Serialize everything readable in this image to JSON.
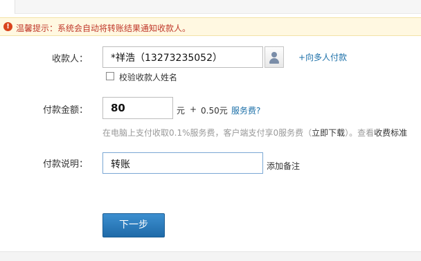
{
  "notice": {
    "icon": "exclamation-icon",
    "text": "温馨提示：系统会自动将转账结果通知收款人。"
  },
  "payee": {
    "label": "收款人：",
    "value": "*祥浩（13273235052）",
    "contact_icon": "contact-person-icon",
    "multi_link": "+向多人付款",
    "verify_checkbox_label": "校验收款人姓名",
    "verify_checked": false
  },
  "amount": {
    "label": "付款金额：",
    "value": "80",
    "unit": "元",
    "plus": "+",
    "fee": "0.50元",
    "fee_link": "服务费?",
    "note_prefix": "在电脑上支付收取0.1%服务费，客户端支付享0服务费（",
    "note_download": "立即下载",
    "note_mid": "）。查看",
    "note_standard": "收费标准"
  },
  "memo": {
    "label": "付款说明：",
    "value": "转账",
    "add_note": "添加备注"
  },
  "actions": {
    "next_label": "下一步"
  },
  "colors": {
    "notice_bg": "#fff8e1",
    "notice_text": "#c0392b",
    "link": "#1b6fa8",
    "primary_button": "#2a7bbd"
  }
}
